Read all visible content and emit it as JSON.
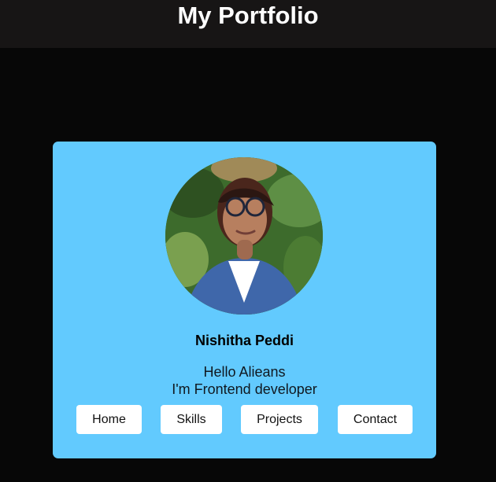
{
  "header": {
    "title": "My Portfolio"
  },
  "profile": {
    "name": "Nishitha Peddi",
    "greeting_line1": "Hello Alieans",
    "greeting_line2": "I'm Frontend developer",
    "avatar_icon": "profile-photo"
  },
  "nav": {
    "items": [
      {
        "label": "Home"
      },
      {
        "label": "Skills"
      },
      {
        "label": "Projects"
      },
      {
        "label": "Contact"
      }
    ]
  },
  "colors": {
    "page_background": "#070707",
    "header_background": "#171515",
    "card_background": "#62cafe",
    "button_background": "#ffffff"
  }
}
